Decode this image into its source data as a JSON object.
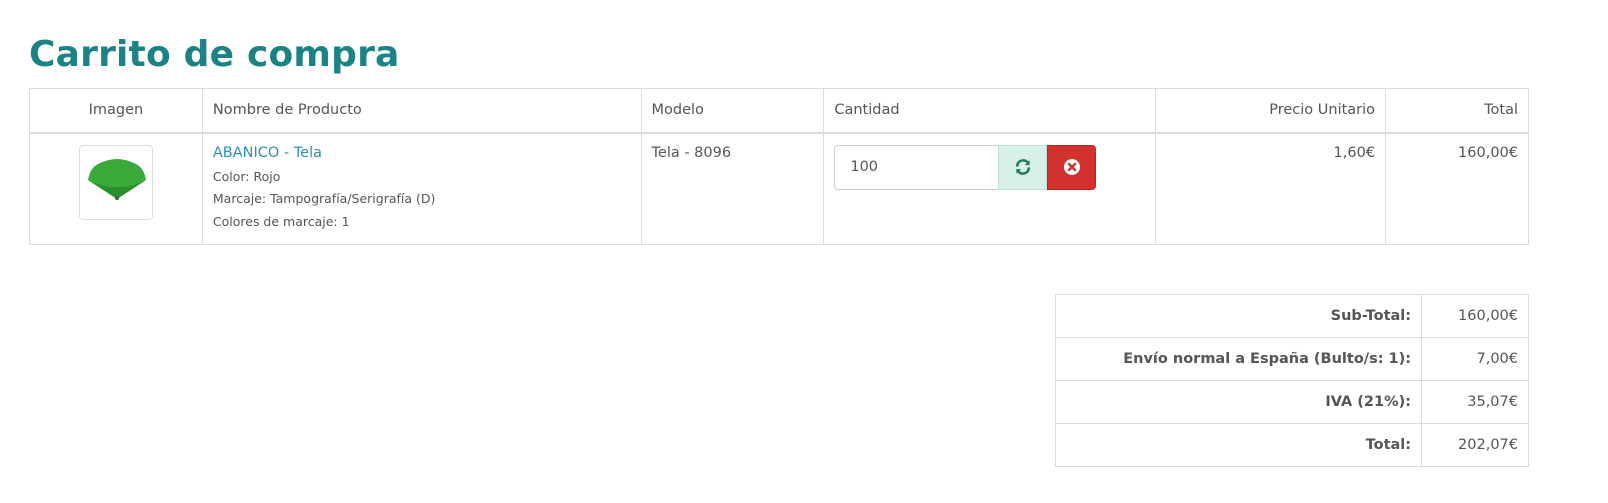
{
  "page": {
    "title": "Carrito de compra"
  },
  "cart": {
    "headers": {
      "image": "Imagen",
      "name": "Nombre de Producto",
      "model": "Modelo",
      "quantity": "Cantidad",
      "unit_price": "Precio Unitario",
      "total": "Total"
    },
    "items": [
      {
        "name": "ABANICO - Tela",
        "options": [
          "Color: Rojo",
          "Marcaje: Tampografía/Serigrafía (D)",
          "Colores de marcaje: 1"
        ],
        "model": "Tela - 8096",
        "quantity": "100",
        "unit_price": "1,60€",
        "total": "160,00€",
        "image_icon": "fan-icon",
        "image_color": "#3aaa3a"
      }
    ]
  },
  "totals": [
    {
      "label": "Sub-Total:",
      "value": "160,00€"
    },
    {
      "label": "Envío normal a España (Bulto/s: 1):",
      "value": "7,00€"
    },
    {
      "label": "IVA (21%):",
      "value": "35,07€"
    },
    {
      "label": "Total:",
      "value": "202,07€"
    }
  ],
  "icons": {
    "update": "refresh-icon",
    "remove": "remove-circle-icon"
  },
  "colors": {
    "title": "#1b8385",
    "link": "#2e8fb4",
    "update_bg": "#d7f0e8",
    "update_icon": "#1f7b68",
    "remove_bg": "#d2322d"
  }
}
